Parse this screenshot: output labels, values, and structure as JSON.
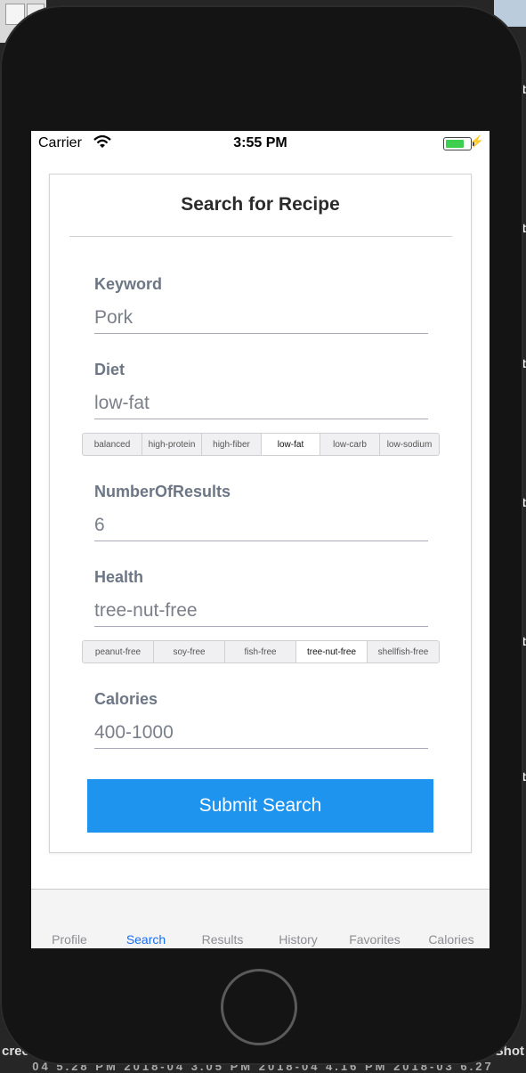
{
  "desktop": {
    "edge_glyph": "t",
    "bottom_left_text": "cree",
    "bottom_right_text": "Shot",
    "bottom_times": "04  5.28 PM  2018-04  3.05 PM  2018-04  4.16 PM  2018-03  6.27"
  },
  "status_bar": {
    "carrier": "Carrier",
    "time": "3:55 PM",
    "battery_color": "#3ecf4e"
  },
  "form": {
    "title": "Search for Recipe",
    "keyword": {
      "label": "Keyword",
      "value": "Pork"
    },
    "diet": {
      "label": "Diet",
      "value": "low-fat",
      "options": [
        "balanced",
        "high-protein",
        "high-fiber",
        "low-fat",
        "low-carb",
        "low-sodium"
      ],
      "selected": "low-fat"
    },
    "number_of_results": {
      "label": "NumberOfResults",
      "value": "6"
    },
    "health": {
      "label": "Health",
      "value": "tree-nut-free",
      "options": [
        "peanut-free",
        "soy-free",
        "fish-free",
        "tree-nut-free",
        "shellfish-free"
      ],
      "selected": "tree-nut-free"
    },
    "calories": {
      "label": "Calories",
      "value": "400-1000"
    },
    "submit_label": "Submit Search",
    "accent_color": "#1e94ee"
  },
  "tab_bar": {
    "tabs": [
      "Profile",
      "Search",
      "Results",
      "History",
      "Favorites",
      "Calories"
    ],
    "active": "Search",
    "active_color": "#1a6ff0"
  },
  "icons": [
    "wifi-icon",
    "battery-icon",
    "charging-bolt-icon",
    "home-button"
  ]
}
